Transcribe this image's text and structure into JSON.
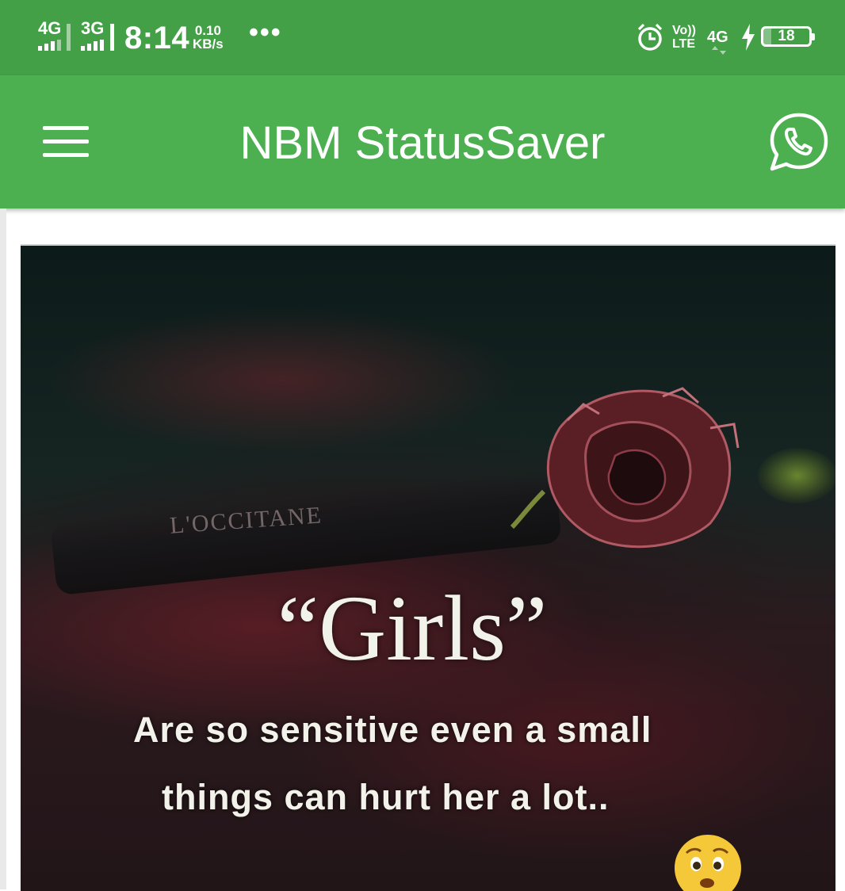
{
  "status_bar": {
    "network_1": "4G",
    "network_2": "3G",
    "time": "8:14",
    "speed_value": "0.10",
    "speed_unit": "KB/s",
    "more": "•••",
    "volte_top": "Vo))",
    "volte_bottom": "LTE",
    "data_type": "4G",
    "battery_level": "18",
    "icons": [
      "signal-icon",
      "alarm-icon",
      "charging-icon",
      "battery-icon"
    ]
  },
  "app_bar": {
    "title": "NBM StatusSaver",
    "menu_icon": "hamburger-menu-icon",
    "action_icon": "whatsapp-icon",
    "color": "#4caf50"
  },
  "status_image": {
    "brand_text": "L'OCCITANE",
    "headline": "“Girls”",
    "line1": "Are so sensitive even a small",
    "line2": "things can hurt her a lot..",
    "emoji": "worried-face-icon"
  },
  "colors": {
    "status_bar": "#43a047",
    "app_bar": "#4caf50",
    "text_on_primary": "#ffffff"
  }
}
